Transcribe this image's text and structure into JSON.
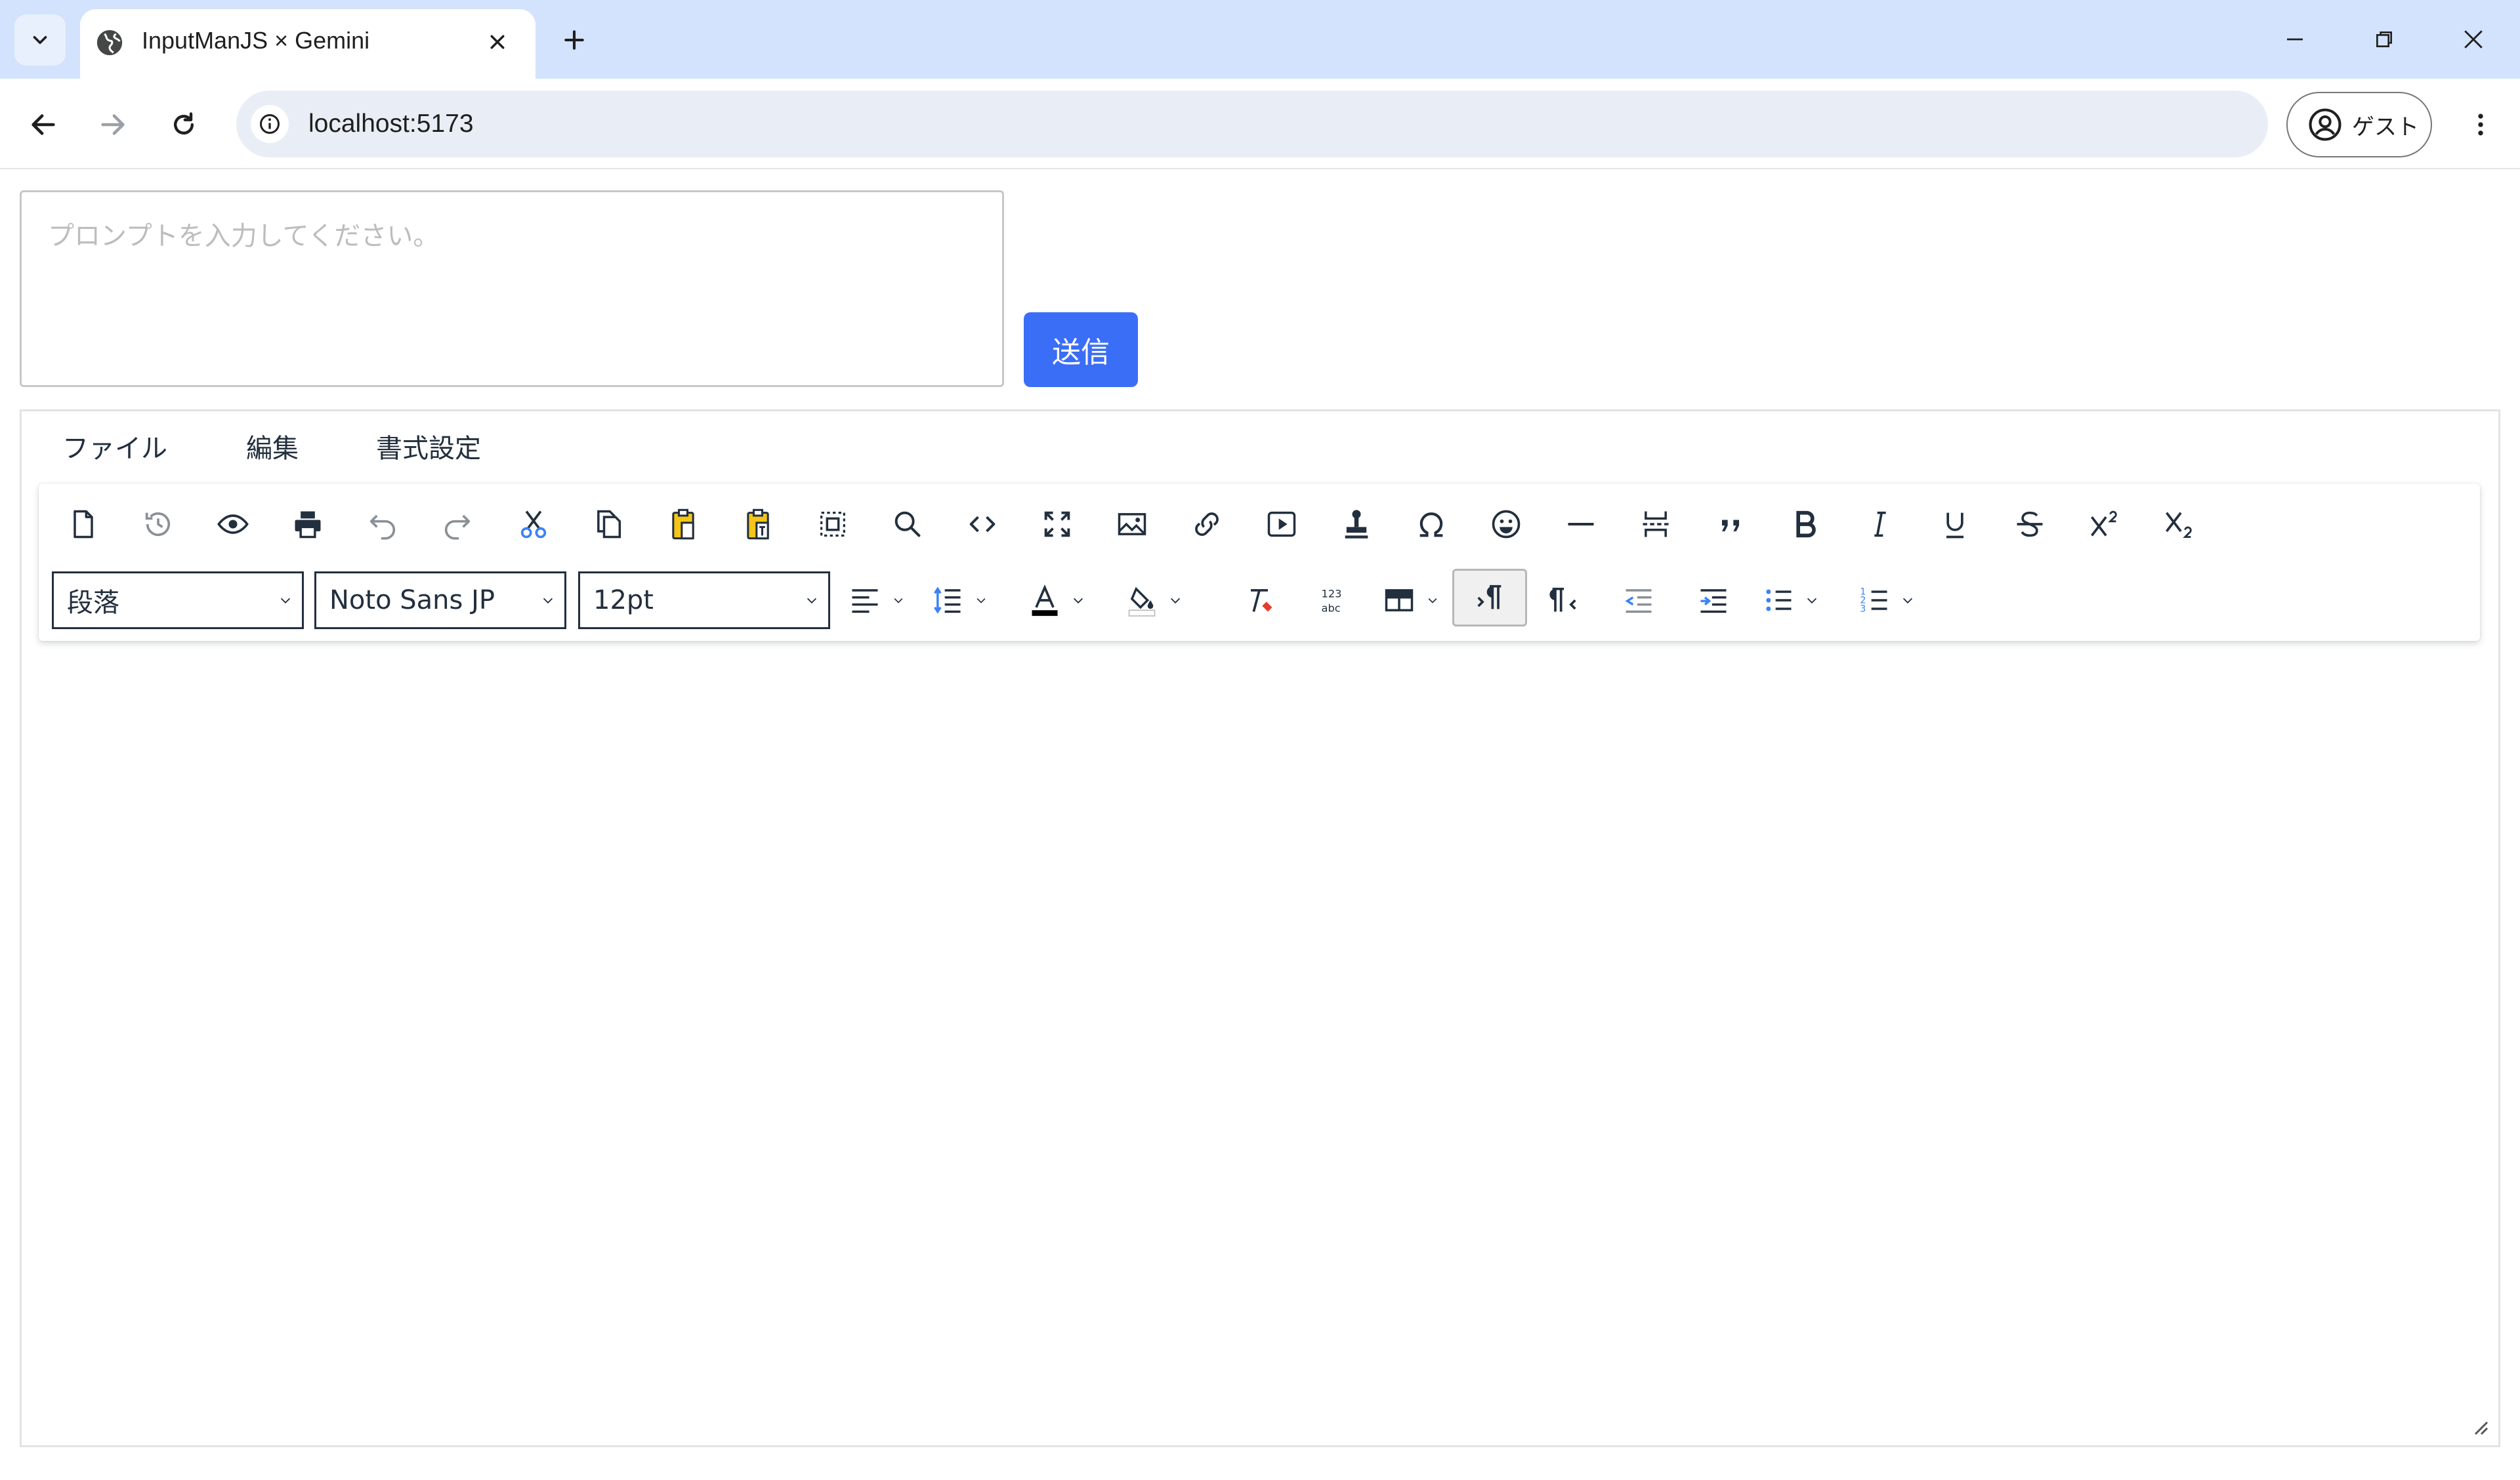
{
  "browser": {
    "tab_title": "InputManJS × Gemini",
    "url": "localhost:5173",
    "profile_label": "ゲスト"
  },
  "prompt": {
    "placeholder": "プロンプトを入力してください。",
    "value": "",
    "send_label": "送信"
  },
  "editor": {
    "menu": [
      "ファイル",
      "編集",
      "書式設定"
    ],
    "toolbar_row1": [
      "new-document-icon",
      "history-icon",
      "preview-icon",
      "print-icon",
      "undo-icon",
      "redo-icon",
      "cut-icon",
      "copy-icon",
      "paste-icon",
      "paste-text-icon",
      "select-all-icon",
      "search-replace-icon",
      "source-code-icon",
      "fullscreen-icon",
      "image-icon",
      "link-icon",
      "media-icon",
      "stamp-icon",
      "special-character-icon",
      "emoji-icon",
      "horizontal-line-icon",
      "page-break-icon",
      "blockquote-icon",
      "bold-icon",
      "italic-icon",
      "underline-icon",
      "strikethrough-icon",
      "superscript-icon",
      "subscript-icon"
    ],
    "block_format": "段落",
    "font_family": "Noto Sans JP",
    "font_size": "12pt",
    "colors": {
      "text_color": "#000000",
      "highlight_color": "#ffffff",
      "accent": "#3b6ef6",
      "clear_format_red": "#e03e2d",
      "list_blue": "#3b82f6"
    },
    "ltr_active": true
  }
}
